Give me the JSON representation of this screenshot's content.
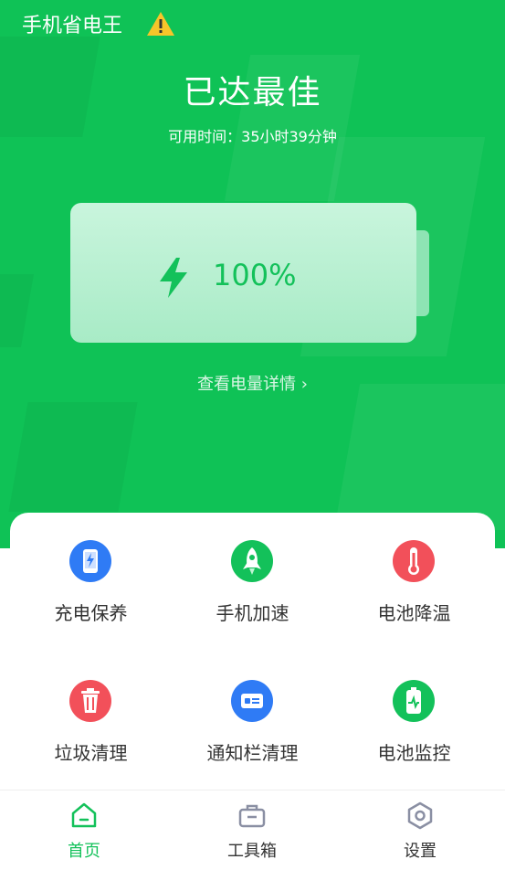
{
  "header": {
    "app_title": "手机省电王",
    "warning_icon": "warning-icon"
  },
  "status": {
    "title": "已达最佳",
    "time_label": "可用时间：",
    "time_value": "35小时39分钟"
  },
  "battery": {
    "level_text": "100%",
    "level_fraction": 1.0,
    "icon": "lightning-bolt-icon",
    "details_link": "查看电量详情 ›"
  },
  "tools": [
    {
      "label": "充电保养",
      "icon": "phone-charge-icon",
      "color": "#2f7bf5"
    },
    {
      "label": "手机加速",
      "icon": "rocket-icon",
      "color": "#13c15a"
    },
    {
      "label": "电池降温",
      "icon": "thermometer-icon",
      "color": "#f2505a"
    },
    {
      "label": "垃圾清理",
      "icon": "trash-icon",
      "color": "#f2505a"
    },
    {
      "label": "通知栏清理",
      "icon": "notification-card-icon",
      "color": "#2f7bf5"
    },
    {
      "label": "电池监控",
      "icon": "battery-monitor-icon",
      "color": "#13c15a"
    }
  ],
  "nav": {
    "home": "首页",
    "toolbox": "工具箱",
    "settings": "设置",
    "active": "home"
  },
  "colors": {
    "accent": "#13c15a",
    "hero_bg": "#0fc256"
  }
}
